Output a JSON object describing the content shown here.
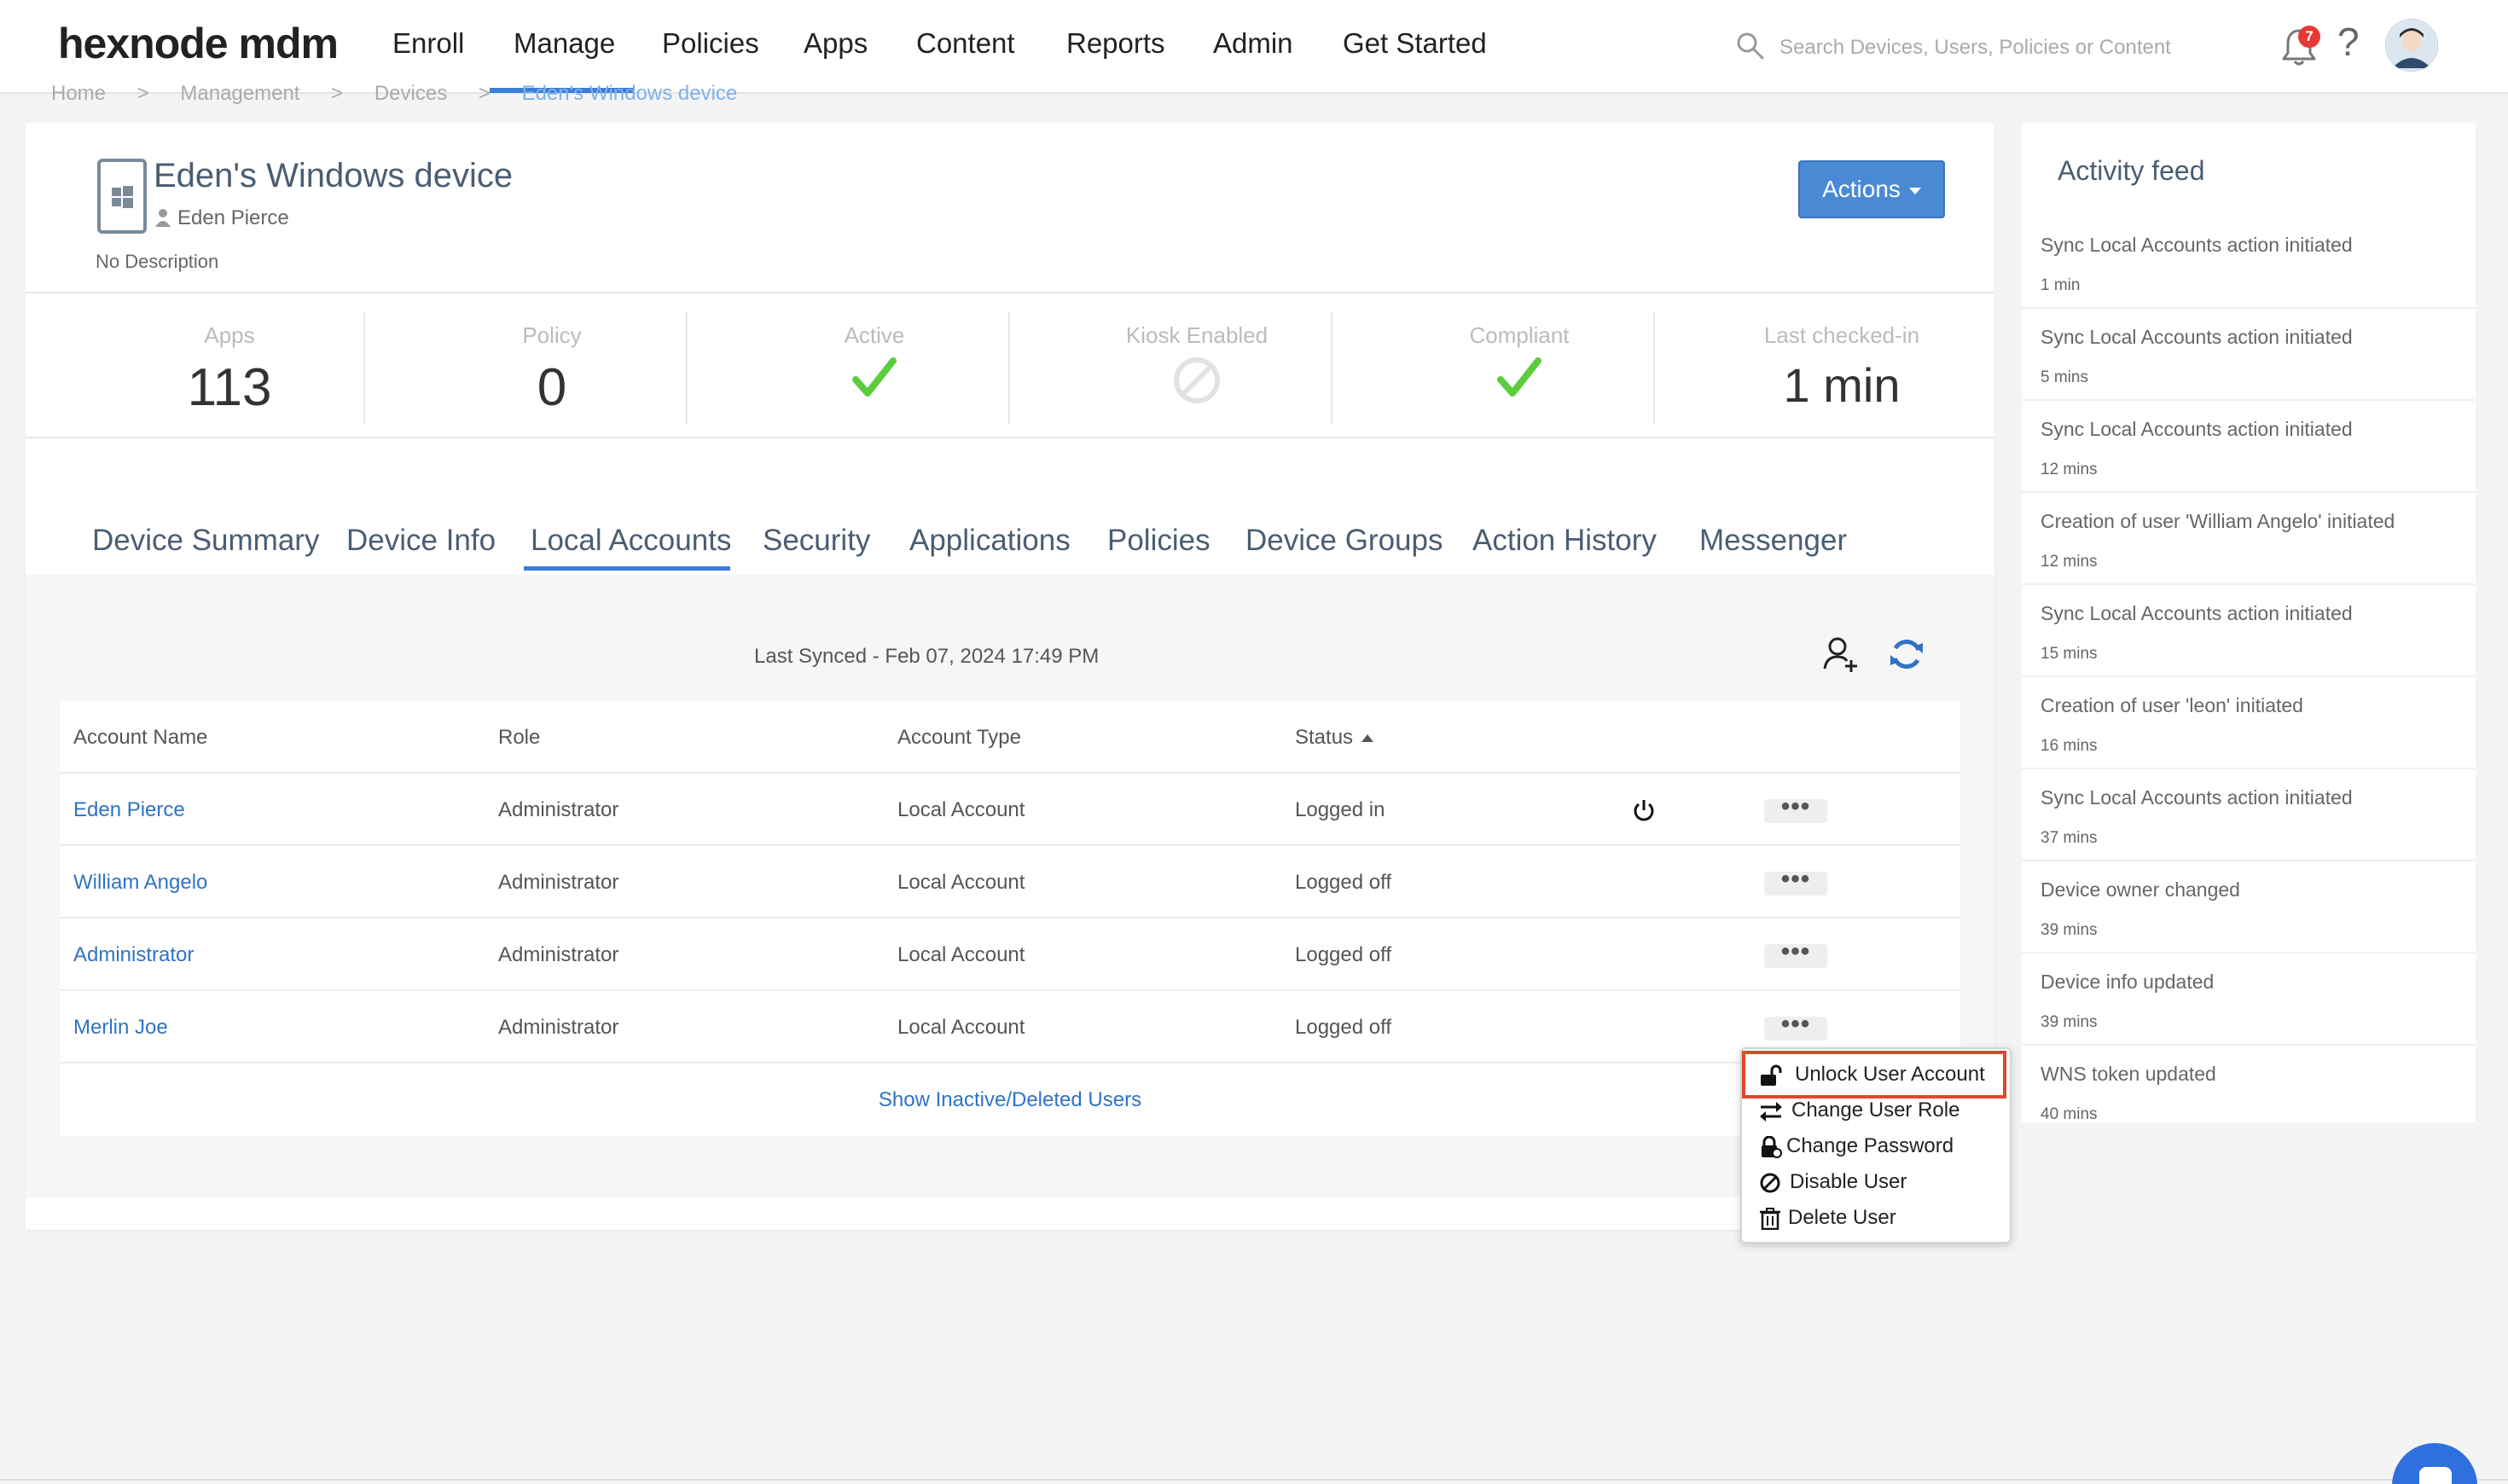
{
  "brand": {
    "logo": "hexnode mdm"
  },
  "nav": {
    "items": [
      "Enroll",
      "Manage",
      "Policies",
      "Apps",
      "Content",
      "Reports",
      "Admin",
      "Get Started"
    ],
    "active": "Manage",
    "search_placeholder": "Search Devices, Users, Policies or Content",
    "notification_count": "7",
    "help": "?"
  },
  "breadcrumb": [
    "Home",
    ">",
    "Management",
    ">",
    "Devices",
    ">",
    "Eden's Windows device"
  ],
  "device": {
    "title": "Eden's Windows device",
    "user": "Eden Pierce",
    "description": "No Description",
    "actions_label": "Actions"
  },
  "stats": [
    {
      "label": "Apps",
      "value": "113"
    },
    {
      "label": "Policy",
      "value": "0"
    },
    {
      "label": "Active",
      "value": ""
    },
    {
      "label": "Kiosk Enabled",
      "value": ""
    },
    {
      "label": "Compliant",
      "value": ""
    },
    {
      "label": "Last checked-in",
      "value": "1 min"
    }
  ],
  "stat_icons": [
    "",
    "",
    "check-icon",
    "disabled-icon",
    "check-icon",
    ""
  ],
  "tabs": [
    "Device Summary",
    "Device Info",
    "Local Accounts",
    "Security",
    "Applications",
    "Policies",
    "Device Groups",
    "Action History",
    "Messenger"
  ],
  "active_tab": "Local Accounts",
  "local_accounts": {
    "last_synced": "Last Synced - Feb 07, 2024 17:49 PM",
    "columns": [
      "Account Name",
      "Role",
      "Account Type",
      "Status"
    ],
    "rows": [
      {
        "name": "Eden Pierce",
        "role": "Administrator",
        "type": "Local Account",
        "status": "Logged in"
      },
      {
        "name": "William Angelo",
        "role": "Administrator",
        "type": "Local Account",
        "status": "Logged off"
      },
      {
        "name": "Administrator",
        "role": "Administrator",
        "type": "Local Account",
        "status": "Logged off"
      },
      {
        "name": "Merlin Joe",
        "role": "Administrator",
        "type": "Local Account",
        "status": "Logged off"
      }
    ],
    "more": "•••",
    "show_inactive": "Show Inactive/Deleted Users"
  },
  "context_menu": {
    "items": [
      "Unlock User Account",
      "Change User Role",
      "Change Password",
      "Disable User",
      "Delete User"
    ],
    "highlighted": "Unlock User Account"
  },
  "activity_feed": {
    "title": "Activity feed",
    "items": [
      {
        "text": "Sync Local Accounts action initiated",
        "time": "1 min"
      },
      {
        "text": "Sync Local Accounts action initiated",
        "time": "5 mins"
      },
      {
        "text": "Sync Local Accounts action initiated",
        "time": "12 mins"
      },
      {
        "text": "Creation of user 'William Angelo' initiated",
        "time": "12 mins"
      },
      {
        "text": "Sync Local Accounts action initiated",
        "time": "15 mins"
      },
      {
        "text": "Creation of user 'leon' initiated",
        "time": "16 mins"
      },
      {
        "text": "Sync Local Accounts action initiated",
        "time": "37 mins"
      },
      {
        "text": "Device owner changed",
        "time": "39 mins"
      },
      {
        "text": "Device info updated",
        "time": "39 mins"
      },
      {
        "text": "WNS token updated",
        "time": "40 mins"
      }
    ]
  },
  "colors": {
    "accent": "#3b7dd8",
    "link": "#2f73c4",
    "check": "#5ccc3c",
    "highlight": "#e0462c"
  }
}
